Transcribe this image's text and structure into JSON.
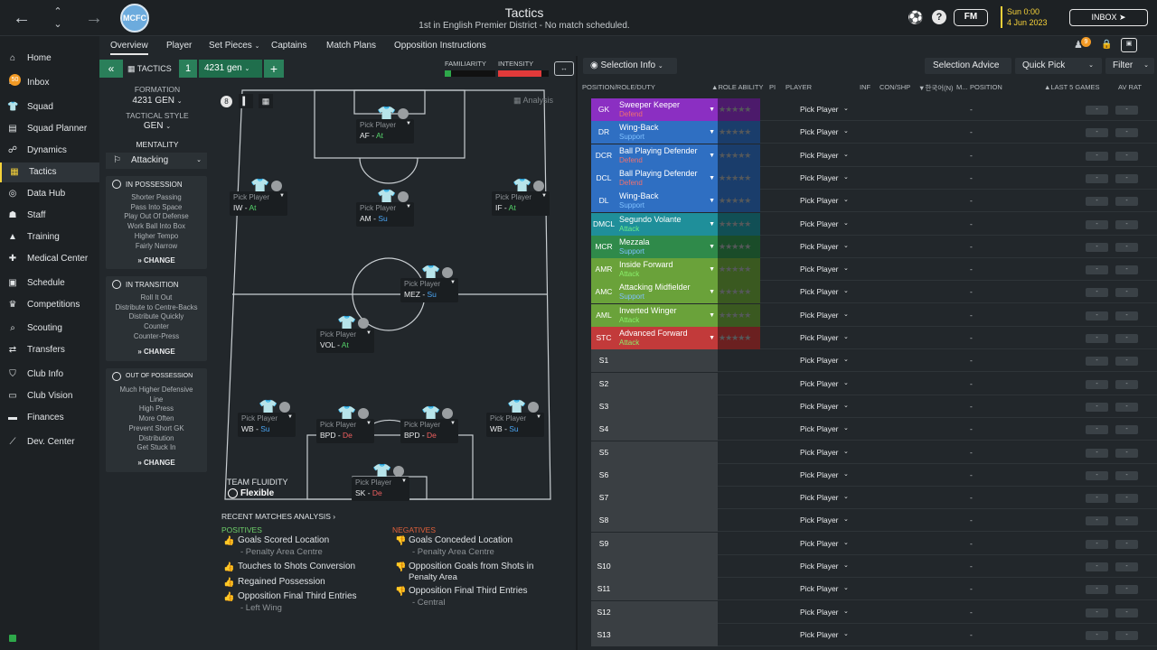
{
  "header": {
    "title": "Tactics",
    "subtitle": "1st in English Premier District - No match scheduled.",
    "crest_text": "MCFC",
    "fm_label": "FM",
    "date_time": "Sun 0:00",
    "date": "4 Jun 2023",
    "inbox_label": "INBOX"
  },
  "sidebar": {
    "items": [
      {
        "label": "Home",
        "icon": "home-icon"
      },
      {
        "label": "Inbox",
        "icon": "inbox-icon",
        "badge": "50"
      },
      {
        "label": "Squad",
        "icon": "shirt-icon"
      },
      {
        "label": "Squad Planner",
        "icon": "planner-icon"
      },
      {
        "label": "Dynamics",
        "icon": "dynamics-icon"
      },
      {
        "label": "Tactics",
        "icon": "tactics-icon"
      },
      {
        "label": "Data Hub",
        "icon": "datahub-icon"
      },
      {
        "label": "Staff",
        "icon": "staff-icon"
      },
      {
        "label": "Training",
        "icon": "training-icon"
      },
      {
        "label": "Medical Center",
        "icon": "medical-icon"
      },
      {
        "label": "Schedule",
        "icon": "schedule-icon"
      },
      {
        "label": "Competitions",
        "icon": "trophy-icon"
      },
      {
        "label": "Scouting",
        "icon": "scouting-icon"
      },
      {
        "label": "Transfers",
        "icon": "transfers-icon"
      },
      {
        "label": "Club Info",
        "icon": "shield-icon"
      },
      {
        "label": "Club Vision",
        "icon": "vision-icon"
      },
      {
        "label": "Finances",
        "icon": "finances-icon"
      },
      {
        "label": "Dev. Center",
        "icon": "dev-icon"
      }
    ]
  },
  "tabs": [
    "Overview",
    "Player",
    "Set Pieces",
    "Captains",
    "Match Plans",
    "Opposition Instructions"
  ],
  "tactic_bar": {
    "label": "TACTICS",
    "slot": "1",
    "name": "4231 gen",
    "familiarity_label": "FAMILIARITY",
    "intensity_label": "INTENSITY",
    "familiarity_level": 0.12,
    "intensity_level": 0.85
  },
  "left_panel": {
    "formation_label": "FORMATION",
    "formation": "4231 GEN",
    "style_label": "TACTICAL STYLE",
    "style": "GEN",
    "mentality_label": "MENTALITY",
    "mentality": "Attacking",
    "in_possession": {
      "title": "IN POSSESSION",
      "lines": [
        "Shorter Passing",
        "Pass Into Space",
        "Play Out Of Defense",
        "Work Ball Into Box",
        "Higher Tempo",
        "Fairly Narrow"
      ]
    },
    "in_transition": {
      "title": "IN TRANSITION",
      "lines": [
        "Roll It Out",
        "Distribute to Centre-Backs",
        "Distribute Quickly",
        "Counter",
        "Counter-Press"
      ]
    },
    "out_of_possession": {
      "title": "OUT OF POSSESSION",
      "lines": [
        "Much Higher Defensive",
        "Line",
        "High Press",
        "More Often",
        "Prevent Short GK",
        "Distribution",
        "Get Stuck In"
      ]
    },
    "change_label": "CHANGE"
  },
  "pitch": {
    "analysis_label": "Analysis",
    "pick_label": "Pick Player",
    "fluidity_label": "TEAM FLUIDITY",
    "fluidity": "Flexible",
    "slots": [
      {
        "role": "AF",
        "duty": "At",
        "duty_class": "at"
      },
      {
        "role": "IW",
        "duty": "At",
        "duty_class": "at"
      },
      {
        "role": "AM",
        "duty": "Su",
        "duty_class": "su"
      },
      {
        "role": "IF",
        "duty": "At",
        "duty_class": "at"
      },
      {
        "role": "MEZ",
        "duty": "Su",
        "duty_class": "su"
      },
      {
        "role": "VOL",
        "duty": "At",
        "duty_class": "at"
      },
      {
        "role": "WB",
        "duty": "Su",
        "duty_class": "su"
      },
      {
        "role": "BPD",
        "duty": "De",
        "duty_class": "de"
      },
      {
        "role": "BPD",
        "duty": "De",
        "duty_class": "de"
      },
      {
        "role": "WB",
        "duty": "Su",
        "duty_class": "su"
      },
      {
        "role": "SK",
        "duty": "De",
        "duty_class": "de"
      }
    ]
  },
  "analysis": {
    "title": "RECENT MATCHES ANALYSIS",
    "positives_label": "POSITIVES",
    "negatives_label": "NEGATIVES",
    "positives": [
      {
        "text": "Goals Scored Location",
        "sub": "- Penalty Area Centre"
      },
      {
        "text": "Touches to Shots Conversion",
        "sub": ""
      },
      {
        "text": "Regained Possession",
        "sub": ""
      },
      {
        "text": "Opposition Final Third Entries",
        "sub": "- Left Wing"
      }
    ],
    "negatives": [
      {
        "text": "Goals Conceded Location",
        "sub": "- Penalty Area Centre"
      },
      {
        "text": "Opposition Goals from Shots in",
        "sub": "Penalty Area"
      },
      {
        "text": "Opposition Final Third Entries",
        "sub": "- Central"
      }
    ]
  },
  "right_panel": {
    "selection_info": "Selection Info",
    "selection_advice": "Selection Advice",
    "quick_pick": "Quick Pick",
    "filter": "Filter",
    "columns": [
      "POSITION/ROLE/DUTY",
      "ROLE ABILITY",
      "PI",
      "PLAYER",
      "INF",
      "CON/SHP",
      "한국어(N)",
      "M...",
      "POSITION",
      "LAST 5 GAMES",
      "AV RAT"
    ],
    "pick_label": "Pick Player",
    "dash": "-",
    "rows": [
      {
        "pos": "GK",
        "role": "Sweeper Keeper",
        "duty": "Defend",
        "color": "#8b2fc2",
        "duty_color": "#f07070"
      },
      {
        "pos": "DR",
        "role": "Wing-Back",
        "duty": "Support",
        "color": "#2f6fc2",
        "duty_color": "#7fc0ff"
      },
      {
        "pos": "DCR",
        "role": "Ball Playing Defender",
        "duty": "Defend",
        "color": "#2f6fc2",
        "duty_color": "#f07070"
      },
      {
        "pos": "DCL",
        "role": "Ball Playing Defender",
        "duty": "Defend",
        "color": "#2f6fc2",
        "duty_color": "#f07070"
      },
      {
        "pos": "DL",
        "role": "Wing-Back",
        "duty": "Support",
        "color": "#2f6fc2",
        "duty_color": "#7fc0ff"
      },
      {
        "pos": "DMCL",
        "role": "Segundo Volante",
        "duty": "Attack",
        "color": "#1f8f9a",
        "duty_color": "#6af08a"
      },
      {
        "pos": "MCR",
        "role": "Mezzala",
        "duty": "Support",
        "color": "#2f8a4a",
        "duty_color": "#7fc0ff"
      },
      {
        "pos": "AMR",
        "role": "Inside Forward",
        "duty": "Attack",
        "color": "#6aa23a",
        "duty_color": "#8af06a"
      },
      {
        "pos": "AMC",
        "role": "Attacking Midfielder",
        "duty": "Support",
        "color": "#6aa23a",
        "duty_color": "#7fc0ff"
      },
      {
        "pos": "AML",
        "role": "Inverted Winger",
        "duty": "Attack",
        "color": "#6aa23a",
        "duty_color": "#8af06a"
      },
      {
        "pos": "STC",
        "role": "Advanced Forward",
        "duty": "Attack",
        "color": "#c23a3a",
        "duty_color": "#8af06a"
      },
      {
        "pos": "S1"
      },
      {
        "pos": "S2"
      },
      {
        "pos": "S3"
      },
      {
        "pos": "S4"
      },
      {
        "pos": "S5"
      },
      {
        "pos": "S6"
      },
      {
        "pos": "S7"
      },
      {
        "pos": "S8"
      },
      {
        "pos": "S9"
      },
      {
        "pos": "S10"
      },
      {
        "pos": "S11"
      },
      {
        "pos": "S12"
      },
      {
        "pos": "S13"
      }
    ]
  }
}
